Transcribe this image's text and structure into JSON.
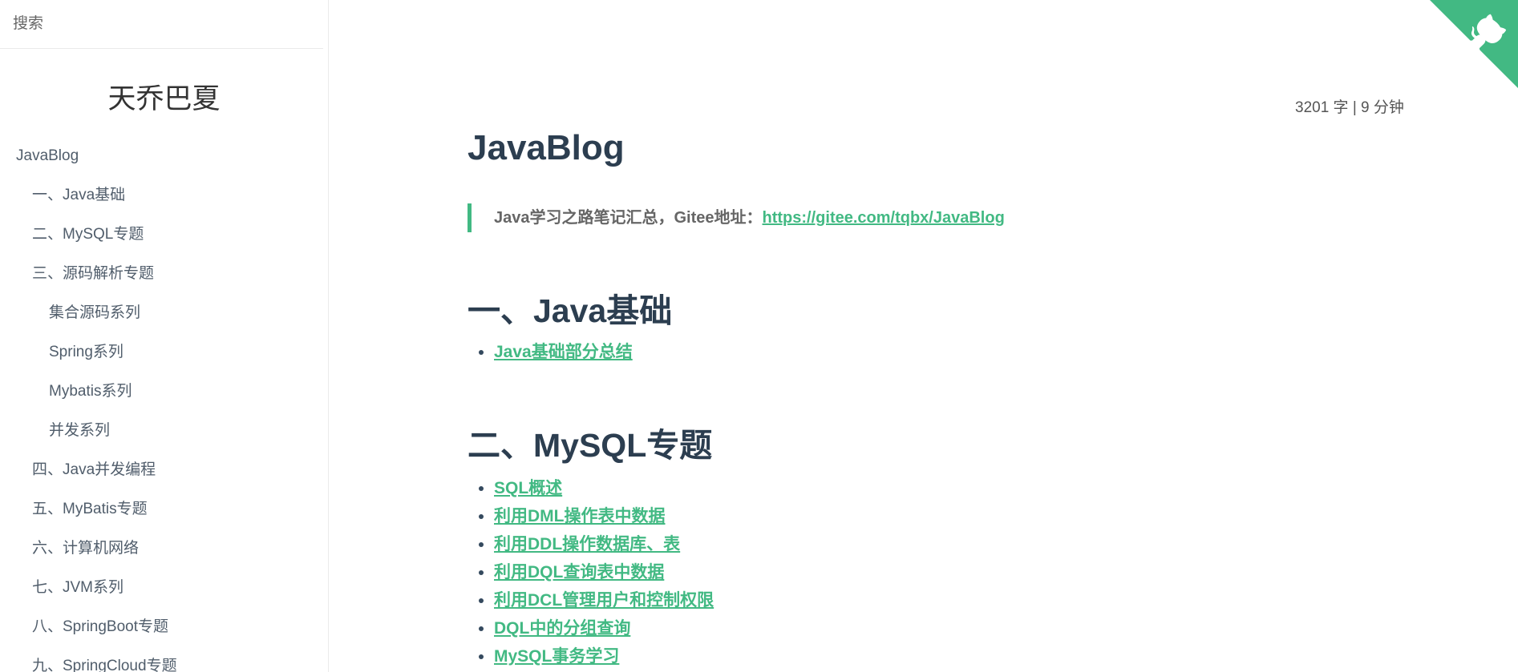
{
  "sidebar": {
    "search_placeholder": "搜索",
    "app_name": "天乔巴夏",
    "items": [
      {
        "label": "JavaBlog"
      },
      {
        "label": "一、Java基础"
      },
      {
        "label": "二、MySQL专题"
      },
      {
        "label": "三、源码解析专题"
      },
      {
        "label": "集合源码系列"
      },
      {
        "label": "Spring系列"
      },
      {
        "label": "Mybatis系列"
      },
      {
        "label": "并发系列"
      },
      {
        "label": "四、Java并发编程"
      },
      {
        "label": "五、MyBatis专题"
      },
      {
        "label": "六、计算机网络"
      },
      {
        "label": "七、JVM系列"
      },
      {
        "label": "八、SpringBoot专题"
      },
      {
        "label": "九、SpringCloud专题"
      }
    ]
  },
  "main": {
    "word_count": "3201 字 | 9 分钟",
    "title": "JavaBlog",
    "quote_text": "Java学习之路笔记汇总，Gitee地址：",
    "quote_link": "https://gitee.com/tqbx/JavaBlog",
    "sections": [
      {
        "heading": "一、Java基础",
        "links": [
          "Java基础部分总结"
        ]
      },
      {
        "heading": "二、MySQL专题",
        "links": [
          "SQL概述",
          "利用DML操作表中数据",
          "利用DDL操作数据库、表",
          "利用DQL查询表中数据",
          "利用DCL管理用户和控制权限",
          "DQL中的分组查询",
          "MySQL事务学习"
        ]
      }
    ]
  },
  "colors": {
    "accent": "#42b983",
    "heading": "#2c3e50",
    "text": "#34495e"
  },
  "icons": {
    "corner": "github-octocat-icon"
  }
}
